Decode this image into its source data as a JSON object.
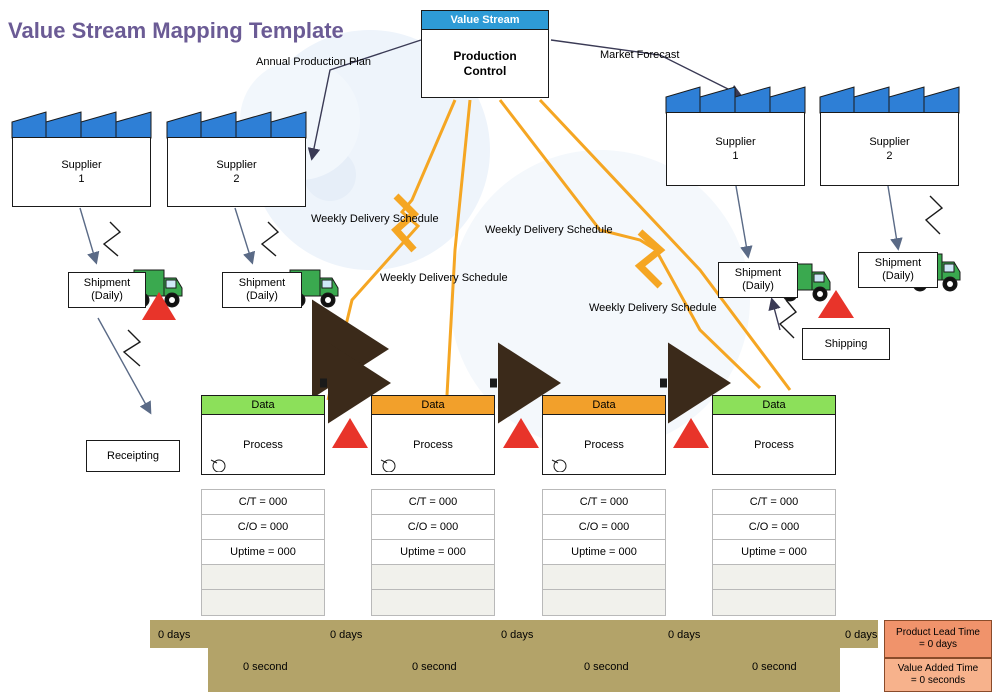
{
  "title": "Value Stream Mapping Template",
  "colors": {
    "title": "#6b5b95",
    "value_stream_header": "#2e9bd6",
    "data_green": "#8ce05a",
    "data_orange": "#f2a02b",
    "timeline_band": "#b3a369",
    "lead_time_box": "#f0936b",
    "value_added_box": "#f7b28c",
    "electronic_arrow": "#f5a623",
    "truck_body": "#3aa94f",
    "push_arrow": "#3b2a1a",
    "inventory_triangle": "#e8342a",
    "roof": "#2e7fd6"
  },
  "production_control": {
    "header": "Value Stream",
    "body": "Production\nControl",
    "body_line1": "Production",
    "body_line2": "Control"
  },
  "suppliers_left": [
    {
      "name": "supplier-1",
      "line1": "Supplier",
      "line2": "1"
    },
    {
      "name": "supplier-2",
      "line1": "Supplier",
      "line2": "2"
    }
  ],
  "customers_right": [
    {
      "name": "customer-1",
      "line1": "Supplier",
      "line2": "1"
    },
    {
      "name": "customer-2",
      "line1": "Supplier",
      "line2": "2"
    }
  ],
  "shipments": [
    {
      "line1": "Shipment",
      "line2": "(Daily)"
    },
    {
      "line1": "Shipment",
      "line2": "(Daily)"
    },
    {
      "line1": "Shipment",
      "line2": "(Daily)"
    },
    {
      "line1": "Shipment",
      "line2": "(Daily)"
    }
  ],
  "labels": {
    "annual_production_plan": "Annual Production Plan",
    "market_forecast": "Market Forecast",
    "weekly_delivery_1": "Weekly Delivery Schedule",
    "weekly_delivery_2": "Weekly Delivery Schedule",
    "weekly_delivery_3": "Weekly Delivery Schedule",
    "weekly_delivery_4": "Weekly Delivery Schedule",
    "receipting": "Receipting",
    "shipping": "Shipping"
  },
  "processes": [
    {
      "header": "Data",
      "header_color": "#8ce05a",
      "body": "Process",
      "metrics": [
        "C/T = 000",
        "C/O = 000",
        "Uptime = 000",
        "",
        ""
      ]
    },
    {
      "header": "Data",
      "header_color": "#f2a02b",
      "body": "Process",
      "metrics": [
        "C/T = 000",
        "C/O = 000",
        "Uptime = 000",
        "",
        ""
      ]
    },
    {
      "header": "Data",
      "header_color": "#f2a02b",
      "body": "Process",
      "metrics": [
        "C/T = 000",
        "C/O = 000",
        "Uptime = 000",
        "",
        ""
      ]
    },
    {
      "header": "Data",
      "header_color": "#8ce05a",
      "body": "Process",
      "metrics": [
        "C/T = 000",
        "C/O = 000",
        "Uptime = 000",
        "",
        ""
      ]
    }
  ],
  "timeline": {
    "days": [
      "0 days",
      "0 days",
      "0 days",
      "0 days",
      "0 days"
    ],
    "seconds": [
      "0 second",
      "0 second",
      "0 second",
      "0 second"
    ]
  },
  "summary": {
    "lead_time_title": "Product Lead Time",
    "lead_time_value": "= 0 days",
    "value_added_title": "Value Added Time",
    "value_added_value": "= 0 seconds"
  }
}
